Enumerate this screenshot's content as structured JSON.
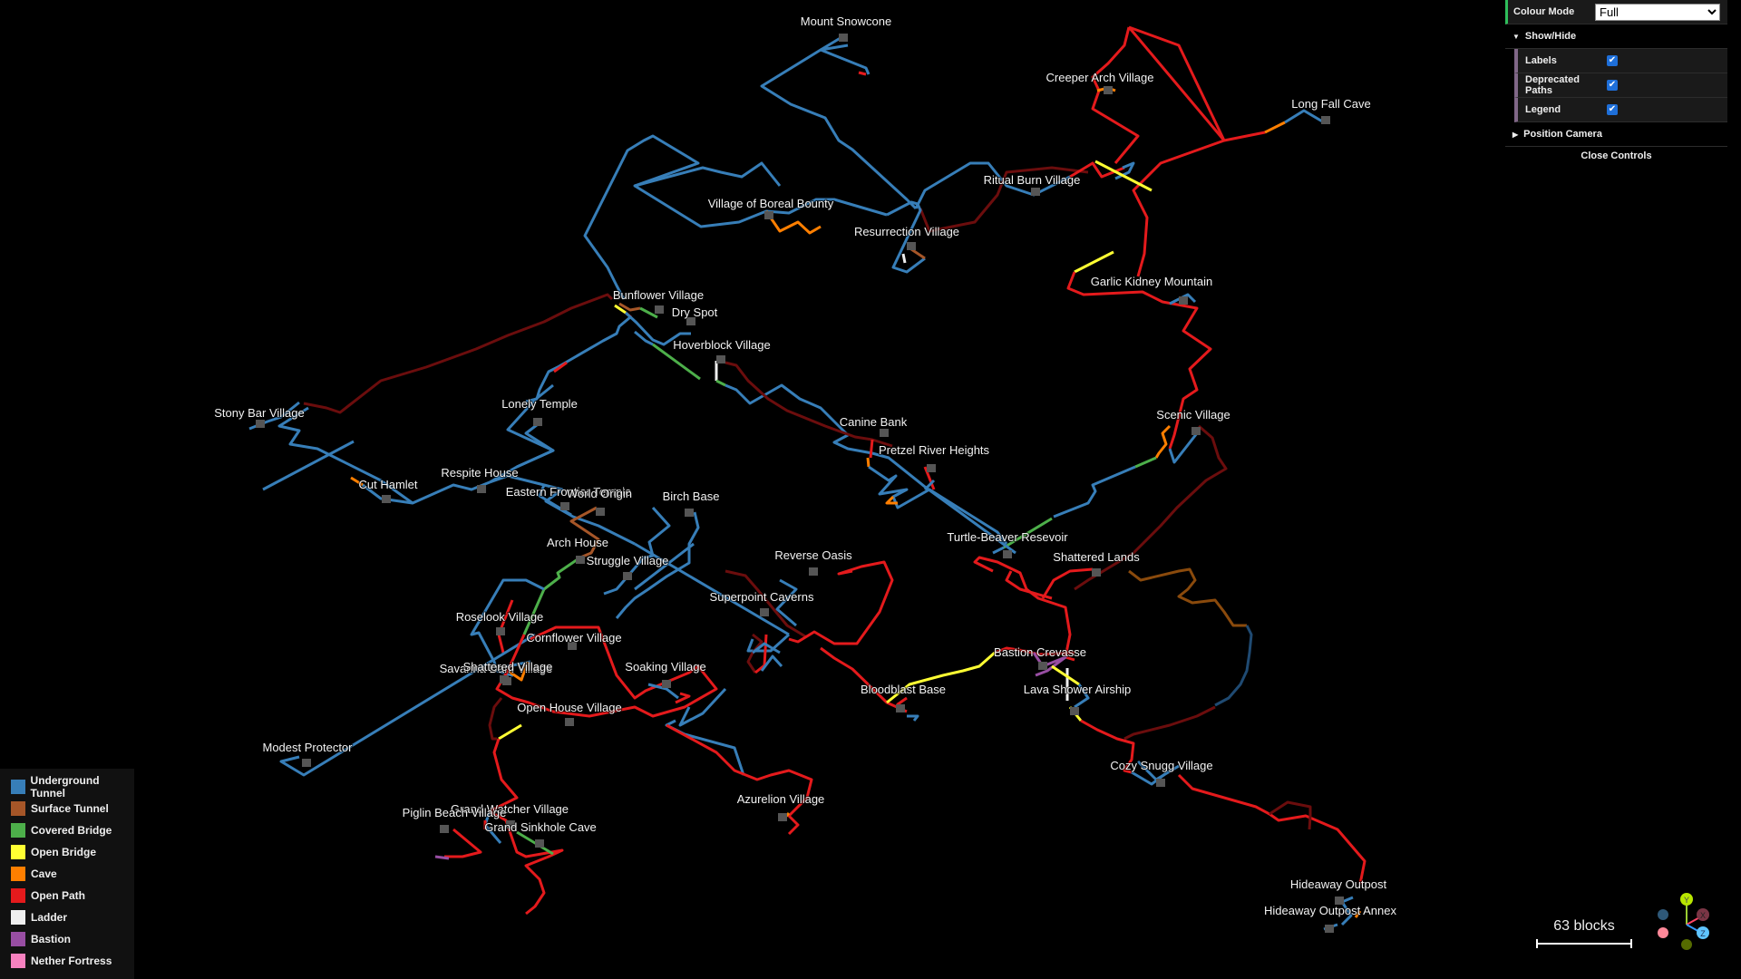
{
  "controls": {
    "colour_mode_label": "Colour Mode",
    "colour_mode_value": "Full",
    "show_hide_label": "Show/Hide",
    "toggles": [
      {
        "label": "Labels",
        "checked": true
      },
      {
        "label": "Deprecated Paths",
        "checked": true
      },
      {
        "label": "Legend",
        "checked": true
      }
    ],
    "position_camera_label": "Position Camera",
    "close_label": "Close Controls"
  },
  "legend": [
    {
      "label": "Underground Tunnel",
      "color": "#377eb8"
    },
    {
      "label": "Surface Tunnel",
      "color": "#a65628"
    },
    {
      "label": "Covered Bridge",
      "color": "#4daf4a"
    },
    {
      "label": "Open Bridge",
      "color": "#ffff33"
    },
    {
      "label": "Cave",
      "color": "#ff7f00"
    },
    {
      "label": "Open Path",
      "color": "#e41a1c"
    },
    {
      "label": "Ladder",
      "color": "#eeeeee"
    },
    {
      "label": "Bastion",
      "color": "#984ea3"
    },
    {
      "label": "Nether Fortress",
      "color": "#f781bf"
    }
  ],
  "deprecated_colors": {
    "open_path": "#6b0d0d",
    "cave": "#8a4a0c",
    "underground_tunnel": "#1f4a72"
  },
  "scale": {
    "label": "63 blocks"
  },
  "axes": [
    "Y",
    "X",
    "Z"
  ],
  "locations": [
    "Mount Snowcone",
    "Creeper Arch Village",
    "Long Fall Cave",
    "Ritual Burn Village",
    "Village of Boreal Bounty",
    "Resurrection Village",
    "Garlic Kidney Mountain",
    "Bunflower Village",
    "Dry Spot",
    "Hoverblock Village",
    "Stony Bar Village",
    "Lonely Temple",
    "Canine Bank",
    "Scenic Village",
    "Pretzel River Heights",
    "Cut Hamlet",
    "Respite House",
    "Eastern Frontier Temple",
    "World Origin",
    "Birch Base",
    "Arch House",
    "Turtle-Beaver Resevoir",
    "Reverse Oasis",
    "Struggle Village",
    "Shattered Lands",
    "Superpoint Caverns",
    "Roselook Village",
    "Cornflower Village",
    "Savanna Dam Village",
    "Shattered Village",
    "Soaking Village",
    "Bastion Crevasse",
    "Bloodblast Base",
    "Lava Shower Airship",
    "Open House Village",
    "Modest Protector",
    "Cozy Snugg Village",
    "Azurelion Village",
    "Grand Watcher Village",
    "Piglin Beach Village",
    "Grand Sinkhole Cave",
    "Hideaway Outpost",
    "Hideaway Outpost Annex"
  ]
}
